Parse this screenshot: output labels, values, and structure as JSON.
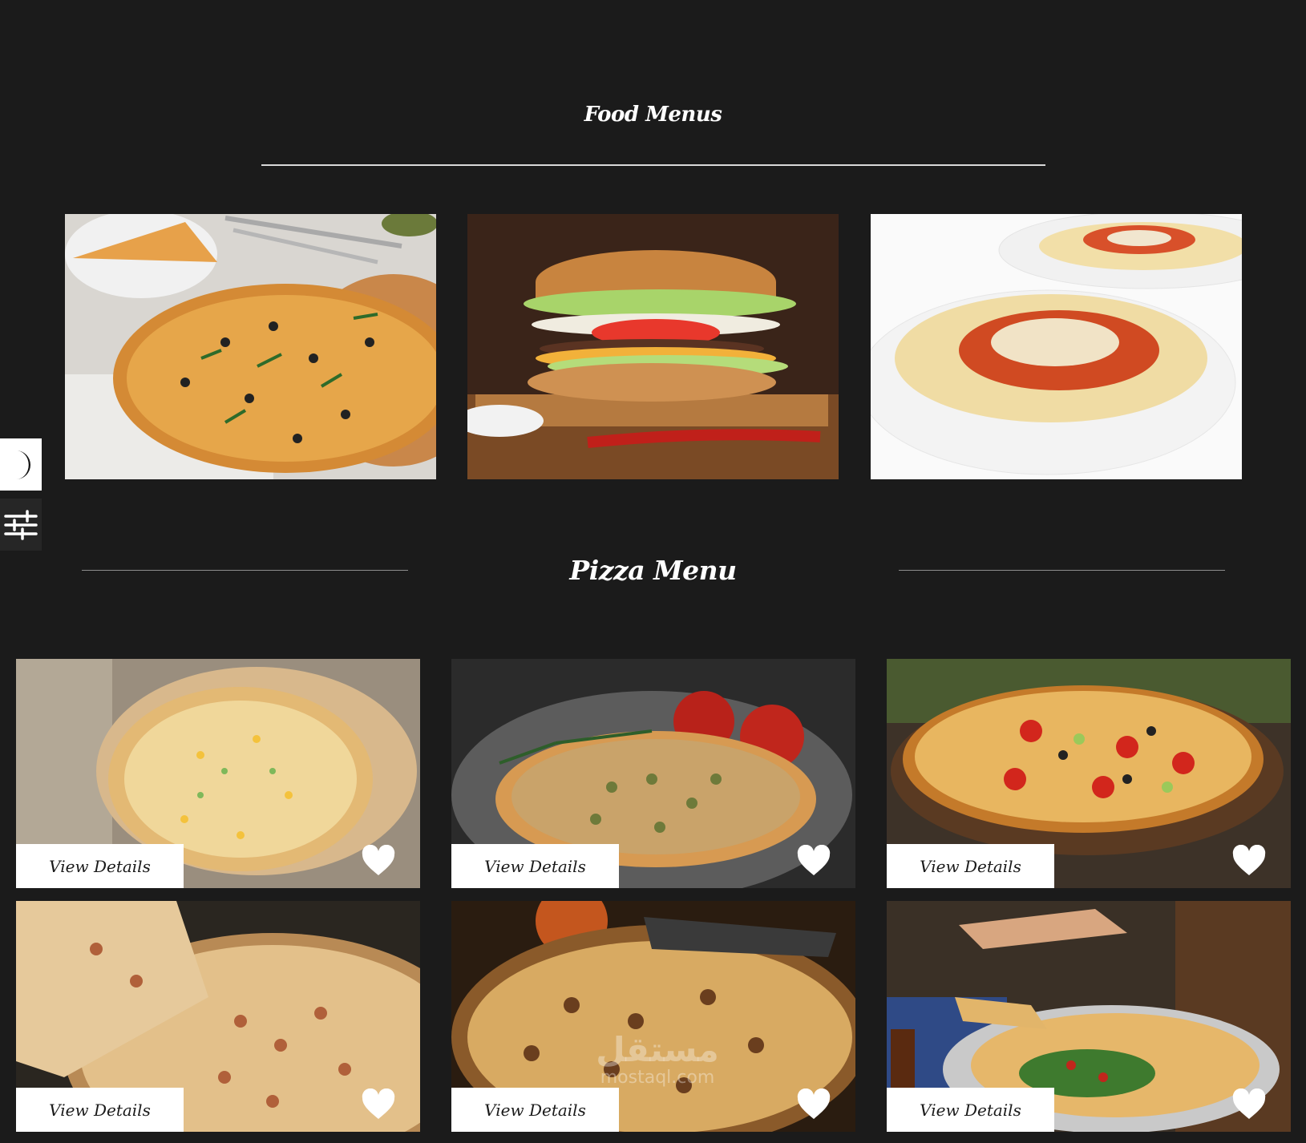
{
  "food_section": {
    "title": "Food Menus",
    "images": [
      {
        "name": "pizza"
      },
      {
        "name": "burger"
      },
      {
        "name": "spaghetti"
      }
    ]
  },
  "side_controls": {
    "theme_icon": "moon-icon",
    "settings_icon": "sliders-icon"
  },
  "pizza_section": {
    "title": "Pizza Menu",
    "cards": [
      {
        "button_label": "View Details",
        "favorite_icon": "heart-icon"
      },
      {
        "button_label": "View Details",
        "favorite_icon": "heart-icon"
      },
      {
        "button_label": "View Details",
        "favorite_icon": "heart-icon"
      },
      {
        "button_label": "View Details",
        "favorite_icon": "heart-icon"
      },
      {
        "button_label": "View Details",
        "favorite_icon": "heart-icon"
      },
      {
        "button_label": "View Details",
        "favorite_icon": "heart-icon"
      }
    ]
  },
  "watermark": {
    "arabic": "مستقل",
    "latin": "mostaql.com"
  },
  "colors": {
    "background": "#1b1b1b",
    "text": "#ffffff",
    "button_bg": "#ffffff",
    "button_text": "#1a1a1a"
  }
}
